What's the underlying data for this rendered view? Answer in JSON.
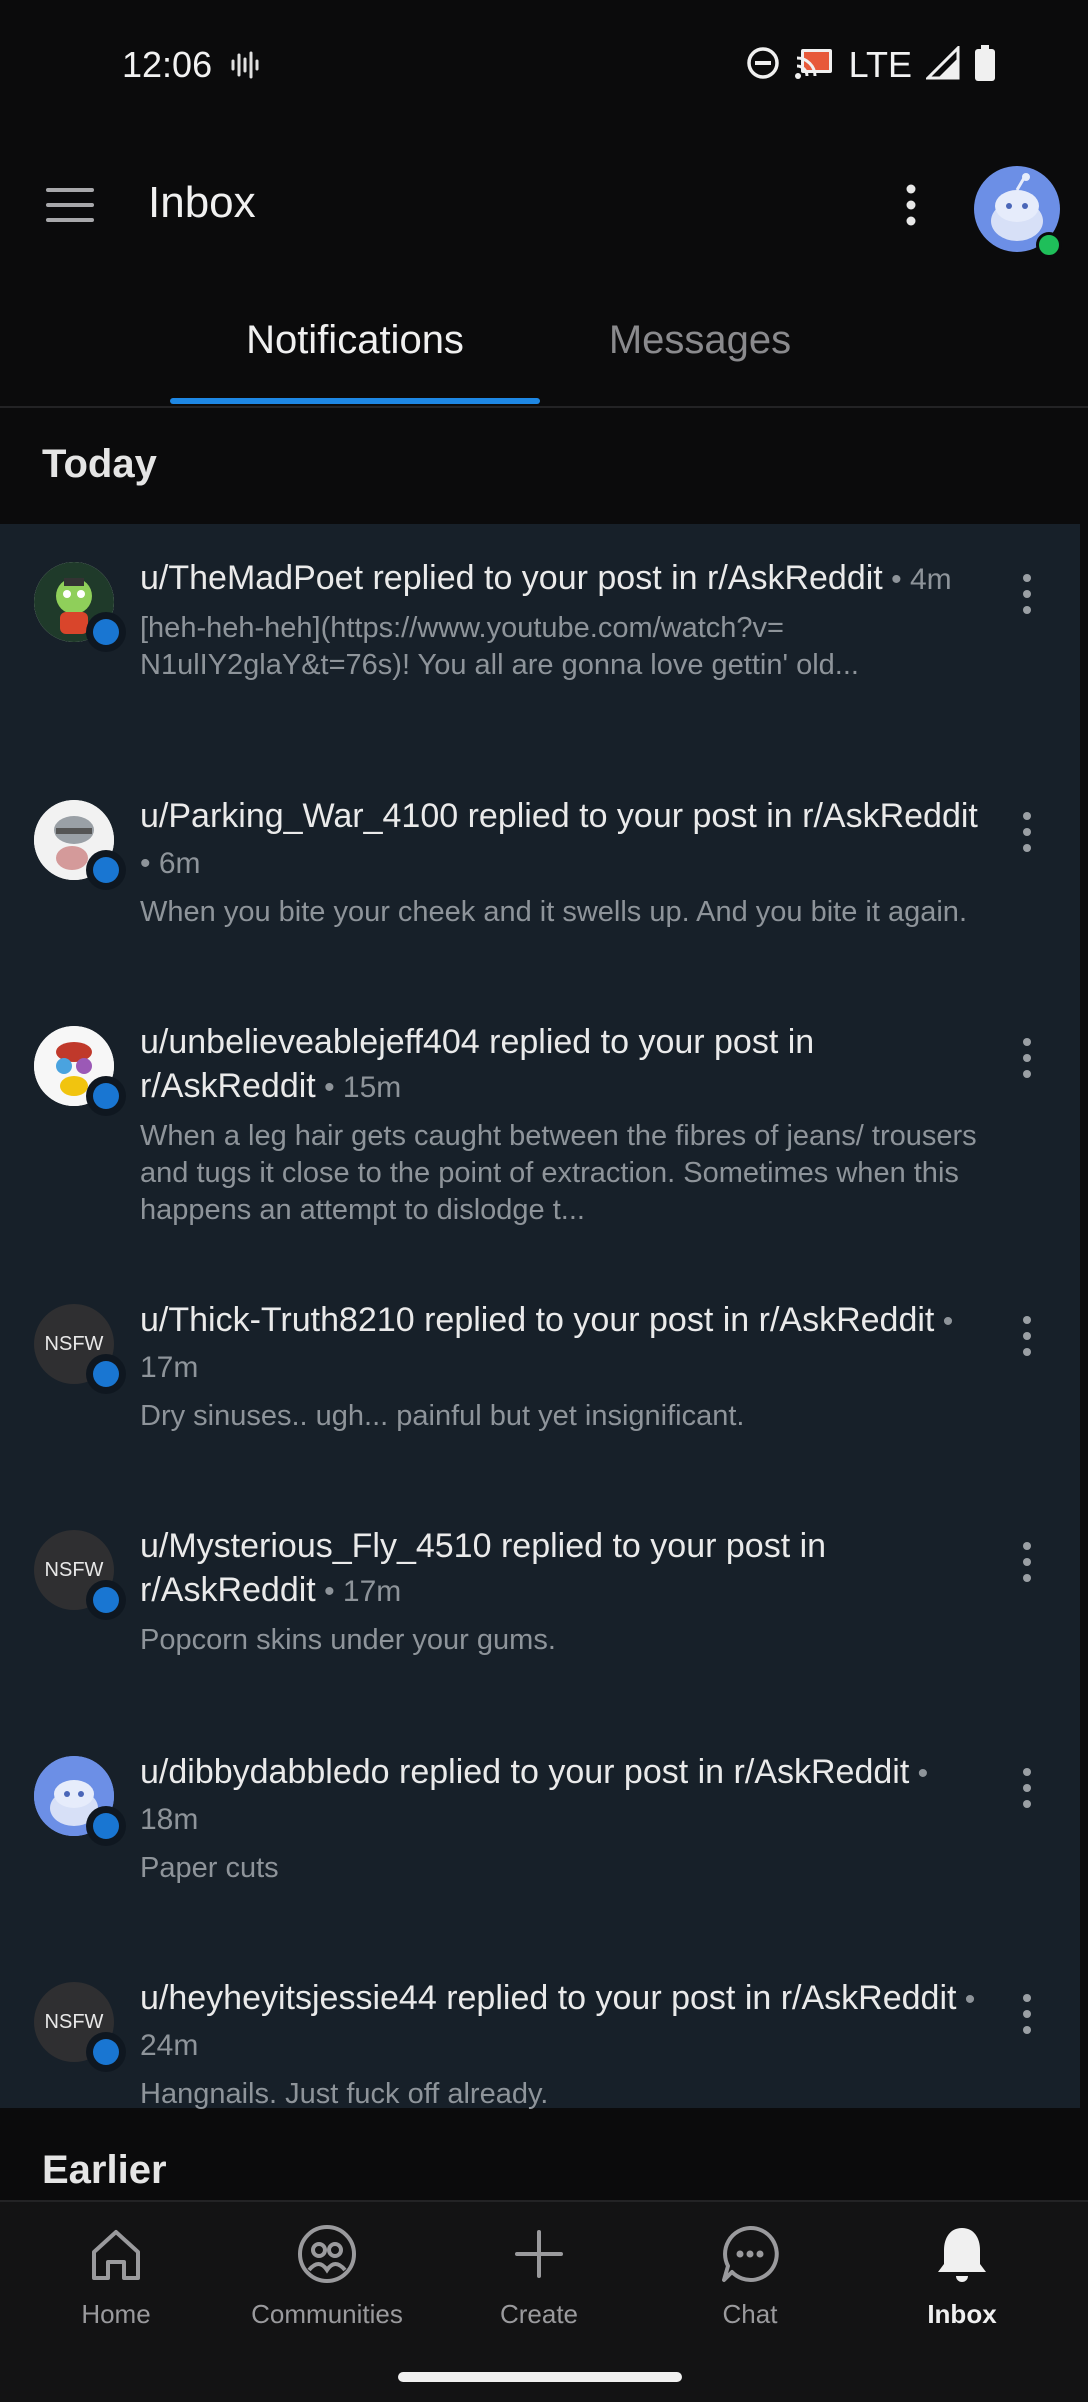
{
  "status_bar": {
    "time": "12:06",
    "network": "LTE"
  },
  "app_bar": {
    "title": "Inbox"
  },
  "tabs": [
    {
      "label": "Notifications",
      "active": true
    },
    {
      "label": "Messages",
      "active": false
    }
  ],
  "sections": {
    "today": "Today",
    "earlier": "Earlier"
  },
  "notifications": [
    {
      "user": "u/TheMadPoet",
      "action": "replied to your post in",
      "subreddit": "r/AskReddit",
      "time": "4m",
      "snippet": "[heh-heh-heh](https://www.youtube.com/watch?v= N1ulIY2glaY&t=76s)! You all are gonna love gettin' old...",
      "avatar": "art"
    },
    {
      "user": "u/Parking_War_4100",
      "action": "replied to your post in",
      "subreddit": "r/AskReddit",
      "time": "6m",
      "snippet": "When you bite your cheek and it swells up. And you bite it again.",
      "avatar": "art"
    },
    {
      "user": "u/unbelieveablejeff404",
      "action": "replied to your post in",
      "subreddit": "r/AskReddit",
      "time": "15m",
      "snippet": "When a leg hair gets caught between the fibres of jeans/ trousers and tugs it close to the point of extraction. Sometimes when this happens an attempt to dislodge t...",
      "avatar": "art"
    },
    {
      "user": "u/Thick-Truth8210",
      "action": "replied to your post in",
      "subreddit": "r/AskReddit",
      "time": "17m",
      "snippet": "Dry sinuses.. ugh... painful but yet insignificant.",
      "avatar": "NSFW"
    },
    {
      "user": "u/Mysterious_Fly_4510",
      "action": "replied to your post in",
      "subreddit": "r/AskReddit",
      "time": "17m",
      "snippet": "Popcorn skins under your gums.",
      "avatar": "NSFW"
    },
    {
      "user": "u/dibbydabbledo",
      "action": "replied to your post in",
      "subreddit": "r/AskReddit",
      "time": "18m",
      "snippet": "Paper cuts",
      "avatar": "snoo"
    },
    {
      "user": "u/heyheyitsjessie44",
      "action": "replied to your post in",
      "subreddit": "r/AskReddit",
      "time": "24m",
      "snippet": "Hangnails.  Just fuck off already.",
      "avatar": "NSFW"
    }
  ],
  "bottom_nav": [
    {
      "label": "Home",
      "icon": "home-icon",
      "active": false
    },
    {
      "label": "Communities",
      "icon": "communities-icon",
      "active": false
    },
    {
      "label": "Create",
      "icon": "plus-icon",
      "active": false
    },
    {
      "label": "Chat",
      "icon": "chat-icon",
      "active": false
    },
    {
      "label": "Inbox",
      "icon": "bell-icon",
      "active": true
    }
  ],
  "colors": {
    "accent": "#1e88e5",
    "list_bg": "#172029",
    "online": "#1fbf5a"
  }
}
